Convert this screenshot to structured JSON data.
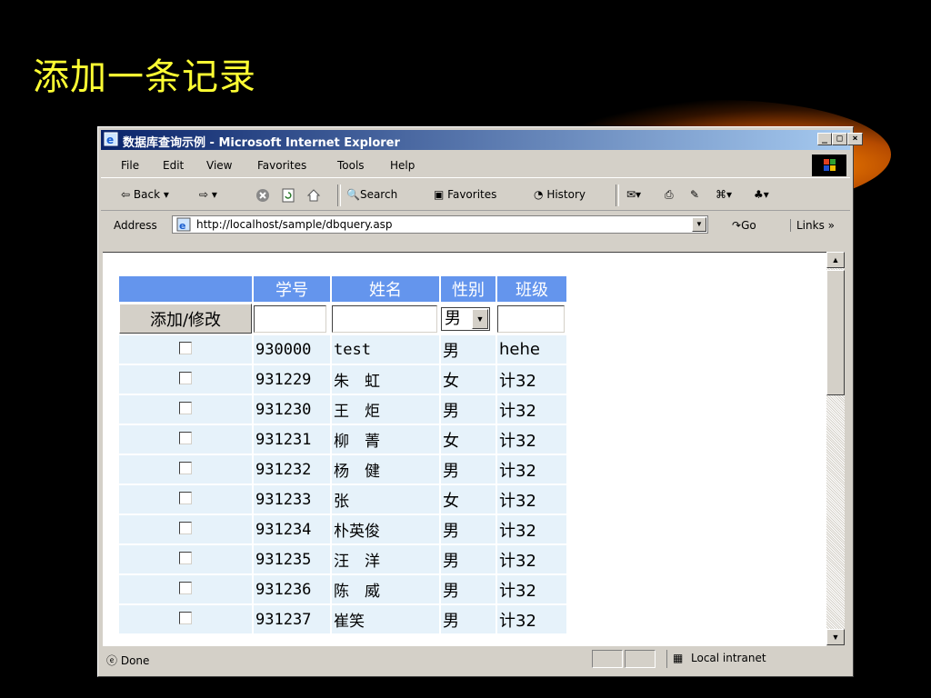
{
  "slide": {
    "title": "添加一条记录"
  },
  "window": {
    "title": "数据库查询示例 - Microsoft Internet Explorer",
    "menu": [
      "File",
      "Edit",
      "View",
      "Favorites",
      "Tools",
      "Help"
    ],
    "toolbar": {
      "back": "Back",
      "search": "Search",
      "favorites": "Favorites",
      "history": "History"
    },
    "address": {
      "label": "Address",
      "url": "http://localhost/sample/dbquery.asp",
      "go": "Go",
      "links": "Links"
    },
    "status": {
      "left": "Done",
      "zone": "Local intranet"
    }
  },
  "table": {
    "headers": [
      "学号",
      "姓名",
      "性别",
      "班级"
    ],
    "add_button": "添加/修改",
    "gender_default": "男",
    "rows": [
      {
        "id": "930000",
        "name": "test",
        "sex": "男",
        "class": "hehe"
      },
      {
        "id": "931229",
        "name": "朱　虹",
        "sex": "女",
        "class": "计32"
      },
      {
        "id": "931230",
        "name": "王　炬",
        "sex": "男",
        "class": "计32"
      },
      {
        "id": "931231",
        "name": "柳　菁",
        "sex": "女",
        "class": "计32"
      },
      {
        "id": "931232",
        "name": "杨　健",
        "sex": "男",
        "class": "计32"
      },
      {
        "id": "931233",
        "name": "张",
        "sex": "女",
        "class": "计32"
      },
      {
        "id": "931234",
        "name": "朴英俊",
        "sex": "男",
        "class": "计32"
      },
      {
        "id": "931235",
        "name": "汪　洋",
        "sex": "男",
        "class": "计32"
      },
      {
        "id": "931236",
        "name": "陈　威",
        "sex": "男",
        "class": "计32"
      },
      {
        "id": "931237",
        "name": "崔笑",
        "sex": "男",
        "class": "计32"
      }
    ]
  }
}
